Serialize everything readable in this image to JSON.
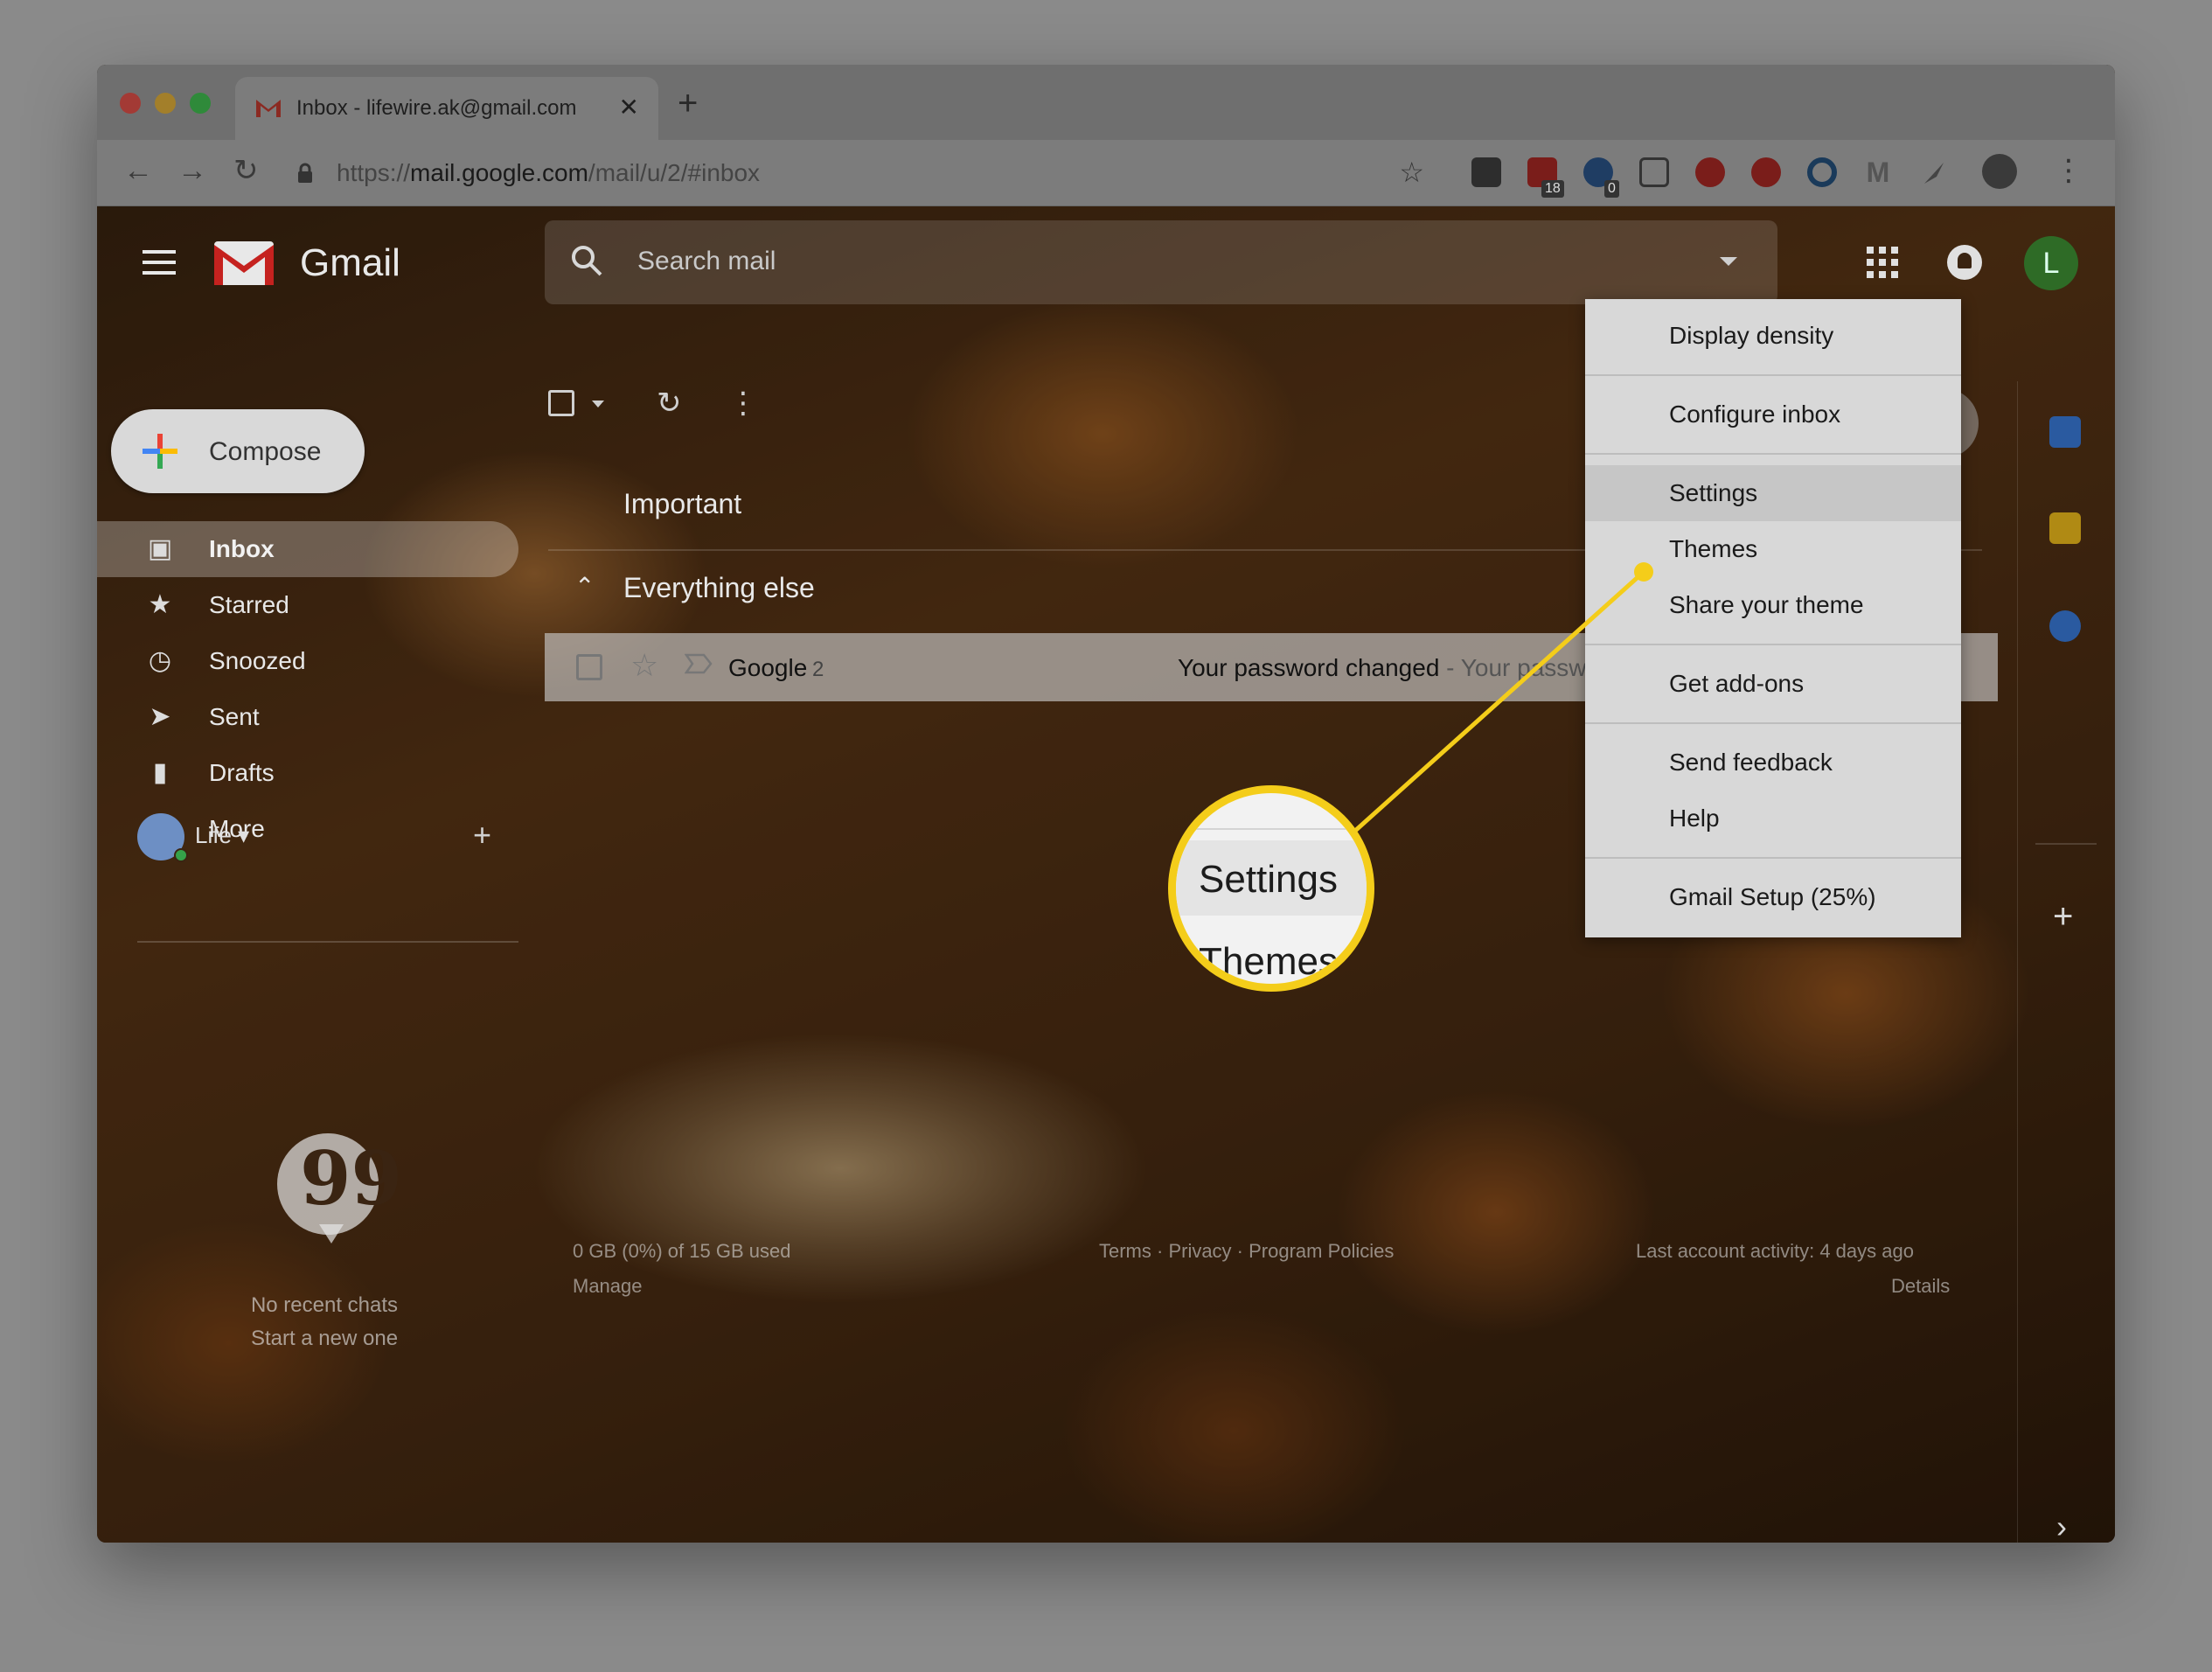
{
  "browser": {
    "tab_title": "Inbox - lifewire.ak@gmail.com",
    "tab_close": "✕",
    "new_tab": "+",
    "url_scheme": "https://",
    "url_host": "mail.google.com",
    "url_path": "/mail/u/2/#inbox",
    "extension_badges": [
      "18",
      "0"
    ]
  },
  "gmail": {
    "logo_text": "Gmail",
    "search_placeholder": "Search mail",
    "account_initial": "L",
    "compose_label": "Compose",
    "nav": [
      {
        "label": "Inbox",
        "icon": "inbox-icon"
      },
      {
        "label": "Starred",
        "icon": "star-icon"
      },
      {
        "label": "Snoozed",
        "icon": "clock-icon"
      },
      {
        "label": "Sent",
        "icon": "send-icon"
      },
      {
        "label": "Drafts",
        "icon": "file-icon"
      },
      {
        "label": "More",
        "icon": "chevron-down-icon"
      }
    ],
    "hangouts_user": "Life",
    "hangouts_add": "+",
    "no_chats": "No recent chats",
    "start_new": "Start a new one",
    "sections": {
      "important": "Important",
      "everything_else": "Everything else"
    },
    "email": {
      "sender": "Google",
      "count": "2",
      "subject": "Your password changed",
      "snippet": " - Your password cha"
    },
    "footer": {
      "storage": "0 GB (0%) of 15 GB used",
      "manage": "Manage",
      "links": "Terms · Privacy · Program Policies",
      "activity": "Last account activity: 4 days ago",
      "details": "Details"
    }
  },
  "settings_menu": {
    "items": [
      "Display density",
      "Configure inbox",
      "Settings",
      "Themes",
      "Share your theme",
      "Get add-ons",
      "Send feedback",
      "Help",
      "Gmail Setup (25%)"
    ],
    "highlighted": "Settings"
  },
  "callout": {
    "primary": "Settings",
    "secondary": "Themes",
    "color": "#f4cd1a"
  },
  "colors": {
    "gmail_red": "#c5221f",
    "avatar_green": "#2e6b26"
  }
}
